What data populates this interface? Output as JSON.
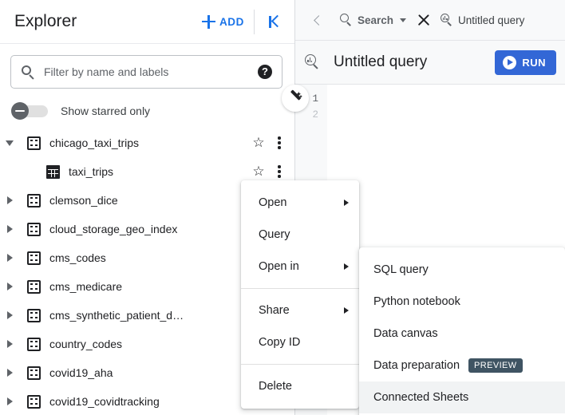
{
  "explorer": {
    "title": "Explorer",
    "add_label": "ADD",
    "collapse_tooltip": "Collapse panel",
    "filter": {
      "placeholder": "Filter by name and labels",
      "value": "",
      "help_label": "?"
    },
    "starred_toggle": {
      "label": "Show starred only",
      "state": "off"
    },
    "tree": [
      {
        "label": "chicago_taxi_trips",
        "type": "dataset",
        "level": 0,
        "expanded": true,
        "starred": false,
        "has_kebab": true
      },
      {
        "label": "taxi_trips",
        "type": "table",
        "level": 1,
        "expanded": false,
        "starred": false,
        "has_kebab": true
      },
      {
        "label": "clemson_dice",
        "type": "dataset",
        "level": 0,
        "expanded": false,
        "starred": false,
        "has_kebab": false
      },
      {
        "label": "cloud_storage_geo_index",
        "type": "dataset",
        "level": 0,
        "expanded": false,
        "starred": false,
        "has_kebab": false
      },
      {
        "label": "cms_codes",
        "type": "dataset",
        "level": 0,
        "expanded": false,
        "starred": false,
        "has_kebab": false
      },
      {
        "label": "cms_medicare",
        "type": "dataset",
        "level": 0,
        "expanded": false,
        "starred": false,
        "has_kebab": false
      },
      {
        "label": "cms_synthetic_patient_d…",
        "type": "dataset",
        "level": 0,
        "expanded": false,
        "starred": false,
        "has_kebab": false
      },
      {
        "label": "country_codes",
        "type": "dataset",
        "level": 0,
        "expanded": false,
        "starred": false,
        "has_kebab": false
      },
      {
        "label": "covid19_aha",
        "type": "dataset",
        "level": 0,
        "expanded": false,
        "starred": false,
        "has_kebab": false
      },
      {
        "label": "covid19_covidtracking",
        "type": "dataset",
        "level": 0,
        "expanded": false,
        "starred": false,
        "has_kebab": false
      }
    ]
  },
  "workspace": {
    "tabs": [
      {
        "label": "Search",
        "icon": "search-icon",
        "has_caret": true,
        "has_close": true,
        "active": true
      },
      {
        "label": "Untitled query",
        "icon": "query-icon",
        "has_caret": false,
        "has_close": false,
        "active": false
      }
    ],
    "query_header": {
      "title": "Untitled query",
      "run_label": "RUN"
    },
    "editor": {
      "lines": [
        "1",
        "2"
      ],
      "content": ""
    }
  },
  "context_menu": {
    "items": [
      {
        "label": "Open",
        "submenu": true,
        "separator_after": false
      },
      {
        "label": "Query",
        "submenu": false,
        "separator_after": false
      },
      {
        "label": "Open in",
        "submenu": true,
        "separator_after": true
      },
      {
        "label": "Share",
        "submenu": true,
        "separator_after": false
      },
      {
        "label": "Copy ID",
        "submenu": false,
        "separator_after": true
      },
      {
        "label": "Delete",
        "submenu": false,
        "separator_after": false
      }
    ]
  },
  "context_submenu": {
    "items": [
      {
        "label": "SQL query",
        "badge": null,
        "active": false
      },
      {
        "label": "Python notebook",
        "badge": null,
        "active": false
      },
      {
        "label": "Data canvas",
        "badge": null,
        "active": false
      },
      {
        "label": "Data preparation",
        "badge": "PREVIEW",
        "active": false
      },
      {
        "label": "Connected Sheets",
        "badge": null,
        "active": true
      }
    ]
  },
  "colors": {
    "accent_blue": "#1a73e8",
    "run_blue": "#3367d6",
    "preview_badge": "#3f5463",
    "text_primary": "#202124",
    "text_secondary": "#5f6368",
    "border": "#dadce0",
    "hover": "#f1f3f4"
  }
}
